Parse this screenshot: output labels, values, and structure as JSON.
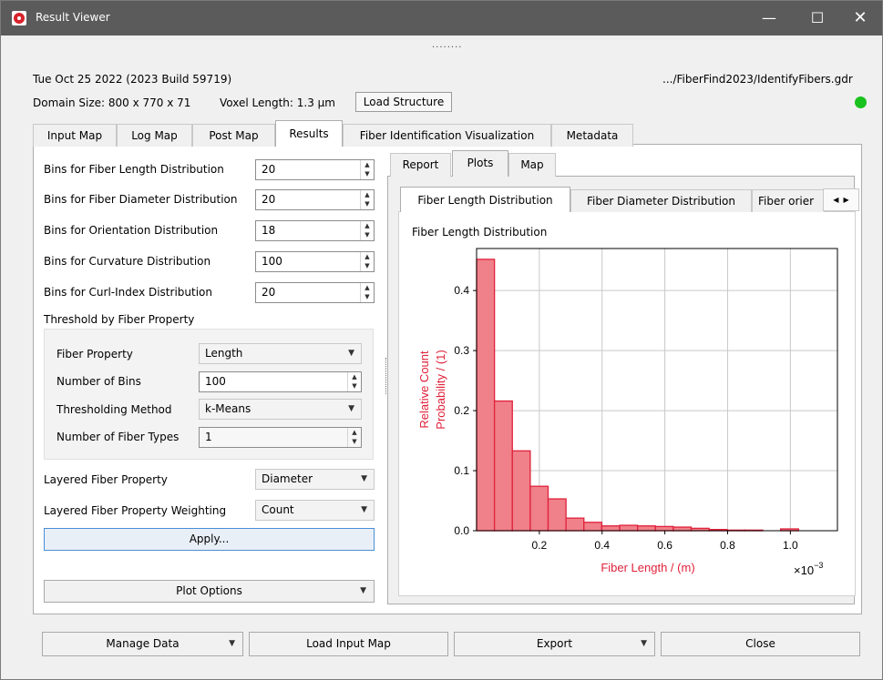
{
  "window": {
    "title": "Result Viewer",
    "grip": "........"
  },
  "header": {
    "datetime": "Tue Oct 25 2022 (2023 Build 59719)",
    "file_path": ".../FiberFind2023/IdentifyFibers.gdr",
    "domain_size": "Domain Size: 800 x 770 x 71",
    "voxel_length": "Voxel Length: 1.3 µm",
    "load_structure": "Load Structure",
    "status_color": "#19c21e"
  },
  "main_tabs": [
    "Input Map",
    "Log Map",
    "Post Map",
    "Results",
    "Fiber Identification Visualization",
    "Metadata"
  ],
  "main_tabs_active": "Results",
  "bins": [
    {
      "label": "Bins for Fiber Length Distribution",
      "value": "20"
    },
    {
      "label": "Bins for Fiber Diameter Distribution",
      "value": "20"
    },
    {
      "label": "Bins for Orientation Distribution",
      "value": "18"
    },
    {
      "label": "Bins for Curvature Distribution",
      "value": "100"
    },
    {
      "label": "Bins for Curl-Index Distribution",
      "value": "20"
    }
  ],
  "threshold": {
    "heading": "Threshold by Fiber Property",
    "fiber_property_label": "Fiber Property",
    "fiber_property_value": "Length",
    "num_bins_label": "Number of Bins",
    "num_bins_value": "100",
    "method_label": "Thresholding Method",
    "method_value": "k-Means",
    "fiber_types_label": "Number of Fiber Types",
    "fiber_types_value": "1"
  },
  "layered": {
    "property_label": "Layered Fiber Property",
    "property_value": "Diameter",
    "weighting_label": "Layered Fiber Property Weighting",
    "weighting_value": "Count"
  },
  "apply_label": "Apply...",
  "plot_options_label": "Plot Options",
  "right_tabs": [
    "Report",
    "Plots",
    "Map"
  ],
  "right_tabs_active": "Plots",
  "plot_tabs": [
    "Fiber Length Distribution",
    "Fiber Diameter Distribution",
    "Fiber orier"
  ],
  "plot_tabs_active": "Fiber Length Distribution",
  "plot_title": "Fiber Length Distribution",
  "chart_data": {
    "type": "bar",
    "title": "",
    "xlabel": "Fiber Length / (m)",
    "ylabel_line1": "Relative Count",
    "ylabel_line2": "Probability / (1)",
    "x_multiplier": "×10",
    "x_multiplier_exp": "−3",
    "xlim": [
      0.0,
      1.15
    ],
    "ylim": [
      0.0,
      0.47
    ],
    "xticks": [
      0.2,
      0.4,
      0.6,
      0.8,
      1.0
    ],
    "xtick_labels": [
      "0.2",
      "0.4",
      "0.6",
      "0.8",
      "1.0"
    ],
    "yticks": [
      0.0,
      0.1,
      0.2,
      0.3,
      0.4
    ],
    "ytick_labels": [
      "0.0",
      "0.1",
      "0.2",
      "0.3",
      "0.4"
    ],
    "grid": true,
    "bar_color": "#f08089",
    "edge_color": "#e0213a",
    "bin_width": 0.057,
    "bin_starts": [
      0.0,
      0.057,
      0.114,
      0.171,
      0.228,
      0.285,
      0.342,
      0.399,
      0.456,
      0.513,
      0.57,
      0.627,
      0.684,
      0.741,
      0.798,
      0.855,
      0.912,
      0.969,
      1.026,
      1.083
    ],
    "values": [
      0.452,
      0.216,
      0.133,
      0.074,
      0.053,
      0.021,
      0.014,
      0.008,
      0.009,
      0.008,
      0.007,
      0.006,
      0.004,
      0.002,
      0.001,
      0.001,
      0.0,
      0.003,
      0.0,
      0.0
    ]
  },
  "bottom_buttons": {
    "manage_data": "Manage Data",
    "load_input_map": "Load Input Map",
    "export": "Export",
    "close": "Close"
  }
}
